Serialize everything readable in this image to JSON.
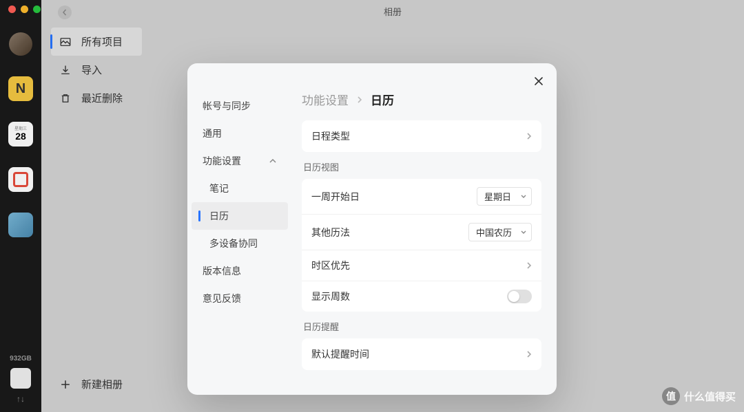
{
  "window": {
    "title": "相册"
  },
  "dock": {
    "calendar_day": "28",
    "storage": "932GB"
  },
  "sidebar": {
    "items": [
      {
        "label": "所有项目"
      },
      {
        "label": "导入"
      },
      {
        "label": "最近删除"
      }
    ],
    "new_album": "新建相册"
  },
  "settings": {
    "nav": {
      "account": "帐号与同步",
      "general": "通用",
      "features": "功能设置",
      "notes": "笔记",
      "calendar": "日历",
      "multi_device": "多设备协同",
      "version": "版本信息",
      "feedback": "意见反馈"
    },
    "breadcrumb": {
      "parent": "功能设置",
      "current": "日历"
    },
    "rows": {
      "schedule_type": "日程类型",
      "view_section": "日历视图",
      "week_start": "一周开始日",
      "week_start_value": "星期日",
      "other_cal": "其他历法",
      "other_cal_value": "中国农历",
      "timezone": "时区优先",
      "show_week_num": "显示周数",
      "reminder_section": "日历提醒",
      "default_reminder": "默认提醒时间"
    }
  },
  "watermark": {
    "text": "什么值得买",
    "badge": "值"
  }
}
